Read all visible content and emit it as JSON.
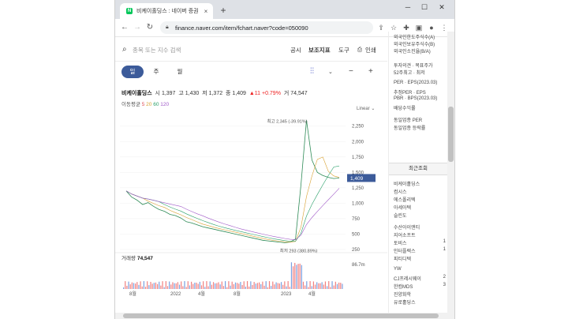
{
  "browser": {
    "tab_title": "비케이홀딩스 : 네이버 증권",
    "tab_close": "×",
    "new_tab": "+",
    "url": "finance.naver.com/item/fchart.naver?code=050090",
    "window_min": "─",
    "window_max": "☐",
    "window_close": "✕"
  },
  "site": {
    "search_placeholder": "종목 또는 지수 검색",
    "links": [
      "공시",
      "보조지표",
      "도구",
      "인쇄"
    ]
  },
  "period_tabs": [
    "일",
    "주",
    "월"
  ],
  "stock": {
    "name": "비케이홀딩스",
    "open_label": "시",
    "open": "1,397",
    "high_label": "고",
    "high": "1,430",
    "low_label": "저",
    "low": "1,372",
    "close_label": "종",
    "close": "1,409",
    "change": "▲11 +0.79%",
    "volume_label": "거",
    "volume": "74,547"
  },
  "moving_average": {
    "label": "이동평균",
    "periods": [
      "5",
      "20",
      "60",
      "120"
    ],
    "colors": [
      "#e0505a",
      "#d8a030",
      "#2aa06a",
      "#a05ac8"
    ]
  },
  "scale_mode": "Linear",
  "chart_data": {
    "type": "line",
    "y_ticks": [
      250,
      500,
      750,
      1000,
      1250,
      1500,
      1750,
      2000,
      2250
    ],
    "ylim": [
      250,
      2400
    ],
    "x_labels": [
      "8월",
      "2022",
      "4월",
      "8월",
      "2023",
      "4월"
    ],
    "price_points": [
      1200,
      1100,
      1050,
      980,
      1010,
      950,
      900,
      870,
      820,
      800,
      760,
      700,
      680,
      650,
      620,
      600,
      580,
      560,
      540,
      520,
      500,
      480,
      460,
      440,
      420,
      400,
      390,
      380,
      370,
      360,
      370,
      420,
      1300,
      2345,
      1700,
      1500,
      1450,
      1420,
      1400,
      1409
    ],
    "high_annotation": "최고 2,345 (-39.91%)",
    "low_annotation": "최저 293 (380.89%)",
    "current_label": "1,409",
    "volume_label": "거래량",
    "volume_value": "74,547",
    "volume_max_label": "86.7m",
    "accent": "#3c5b9a"
  },
  "right_panel": {
    "items_top": [
      "외국인한도주식수(A)",
      "외국인보유주식수(B)",
      "외국인소진율(B/A)",
      "투자의견 · 목표주가",
      "52주최고 · 최저",
      "PER · EPS(2023.03)",
      "추정PER · EPS",
      "PBR · BPS(2023.03)",
      "배당수익률",
      "동일업종 PER",
      "동일업종 등락률"
    ],
    "recent_title": "최근조회",
    "recent_items": [
      "비케이홀딩스",
      "컴시스",
      "에스폴리텍",
      "아세아텍",
      "슬린도",
      "수산아이앤티",
      "지어소프트",
      "토비스",
      "인터플렉스",
      "피티디텍",
      "YW",
      "CJ프레시웨이",
      "한컴MDS",
      "진양화학",
      "유로홀딩스"
    ],
    "recent_nums": [
      "",
      "",
      "",
      "",
      "",
      "",
      "",
      "1",
      "1",
      "",
      "",
      "2",
      "3",
      "",
      ""
    ]
  }
}
